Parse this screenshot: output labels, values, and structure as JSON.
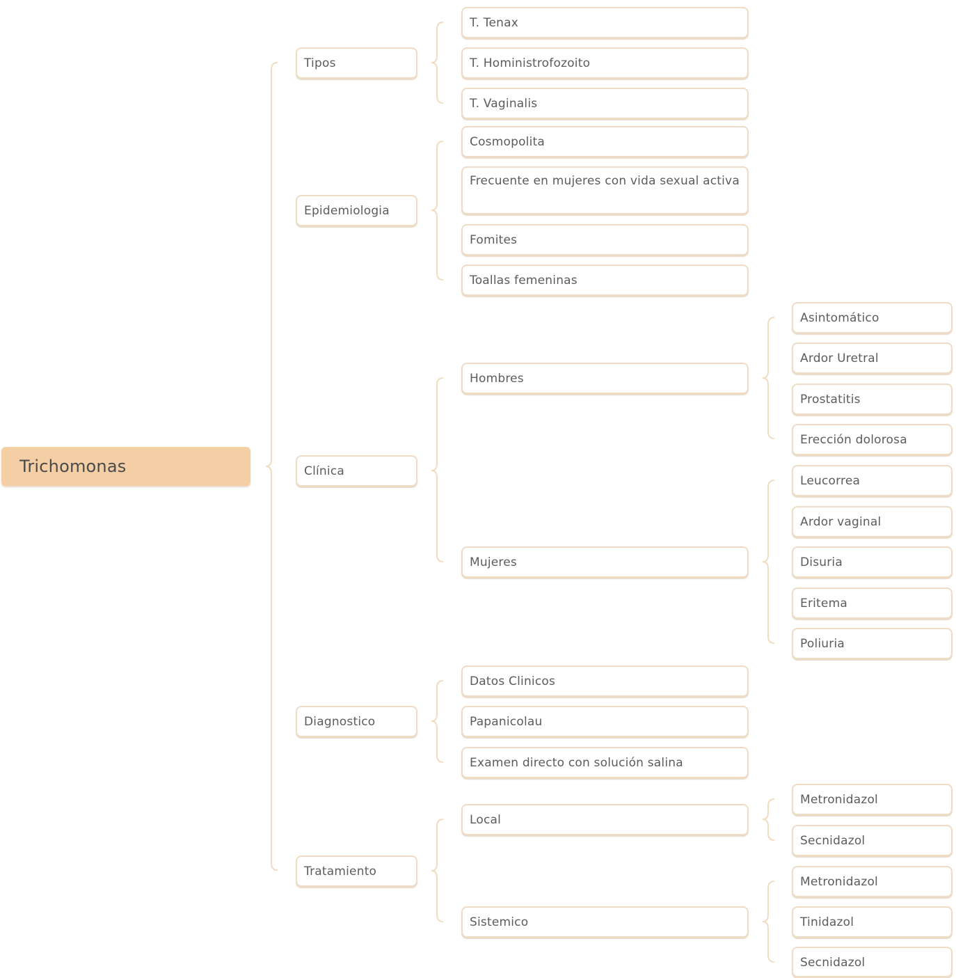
{
  "colors": {
    "root_fill": "#f4cfa5",
    "node_border": "#f0dcc4",
    "connector": "#f1dcc2",
    "text": "#5c5c5c"
  },
  "root": "Trichomonas",
  "branches": [
    {
      "label": "Tipos",
      "children": [
        {
          "label": "T. Tenax"
        },
        {
          "label": "T. Hoministrofozoito"
        },
        {
          "label": "T. Vaginalis"
        }
      ]
    },
    {
      "label": "Epidemiologia",
      "children": [
        {
          "label": "Cosmopolita"
        },
        {
          "label": "Frecuente en mujeres con vida sexual activa"
        },
        {
          "label": "Fomites"
        },
        {
          "label": "Toallas femeninas"
        }
      ]
    },
    {
      "label": "Clínica",
      "children": [
        {
          "label": "Hombres",
          "children": [
            {
              "label": "Asintomático"
            },
            {
              "label": "Ardor Uretral"
            },
            {
              "label": "Prostatitis"
            },
            {
              "label": "Erección dolorosa"
            }
          ]
        },
        {
          "label": "Mujeres",
          "children": [
            {
              "label": "Leucorrea"
            },
            {
              "label": "Ardor vaginal"
            },
            {
              "label": "Disuria"
            },
            {
              "label": "Eritema"
            },
            {
              "label": "Poliuria"
            }
          ]
        }
      ]
    },
    {
      "label": "Diagnostico",
      "children": [
        {
          "label": "Datos Clinicos"
        },
        {
          "label": "Papanicolau"
        },
        {
          "label": "Examen directo con solución salina"
        }
      ]
    },
    {
      "label": "Tratamiento",
      "children": [
        {
          "label": "Local",
          "children": [
            {
              "label": "Metronidazol"
            },
            {
              "label": "Secnidazol"
            }
          ]
        },
        {
          "label": "Sistemico",
          "children": [
            {
              "label": "Metronidazol"
            },
            {
              "label": "Tinidazol"
            },
            {
              "label": "Secnidazol"
            }
          ]
        }
      ]
    }
  ]
}
